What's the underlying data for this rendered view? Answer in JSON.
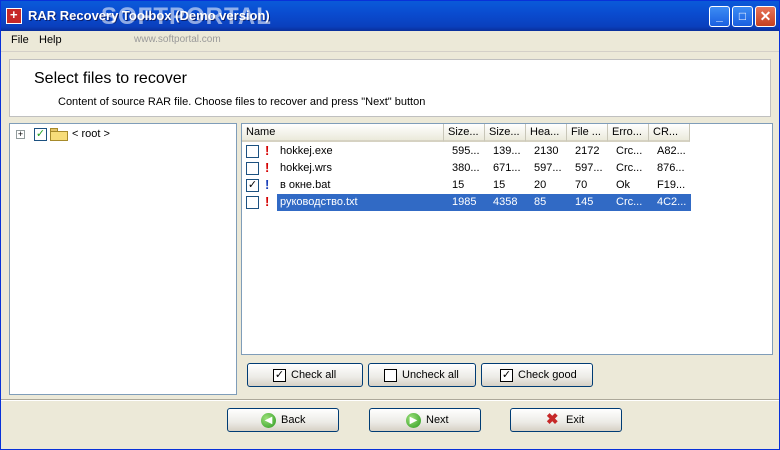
{
  "window": {
    "title": "RAR Recovery Toolbox (Demo version)",
    "watermark": "SOFTPORTAL",
    "controls": {
      "minimize": "_",
      "maximize": "□",
      "close": "✕"
    }
  },
  "menu": {
    "file": "File",
    "help": "Help",
    "watermark_url": "www.softportal.com"
  },
  "header": {
    "title": "Select files to recover",
    "subtitle": "Content of source RAR file. Choose files to recover and press \"Next\" button"
  },
  "tree": {
    "root_label": "< root >",
    "checked": true,
    "expand_glyph": "+"
  },
  "file_list": {
    "columns": [
      "Name",
      "Size...",
      "Size...",
      "Hea...",
      "File ...",
      "Erro...",
      "CR..."
    ],
    "rows": [
      {
        "checked": false,
        "status": "error",
        "cells": [
          "hokkej.exe",
          "595...",
          "139...",
          "2130",
          "2172",
          "Crc...",
          "A82..."
        ]
      },
      {
        "checked": false,
        "status": "error",
        "cells": [
          "hokkej.wrs",
          "380...",
          "671...",
          "597...",
          "597...",
          "Crc...",
          "876..."
        ]
      },
      {
        "checked": true,
        "status": "ok",
        "cells": [
          "в окне.bat",
          "15",
          "15",
          "20",
          "70",
          "Ok",
          "F19..."
        ]
      },
      {
        "checked": false,
        "status": "error",
        "selected": true,
        "cells": [
          "руководство.txt",
          "1985",
          "4358",
          "85",
          "145",
          "Crc...",
          "4C2..."
        ]
      }
    ]
  },
  "check_buttons": {
    "check_all": "Check all",
    "uncheck_all": "Uncheck all",
    "check_good": "Check good"
  },
  "nav_buttons": {
    "back": "Back",
    "next": "Next",
    "exit": "Exit"
  },
  "icons": {
    "error_mark": "!",
    "check_mark": "✓",
    "back_arrow": "◀",
    "next_arrow": "▶",
    "exit_x": "✖"
  },
  "colors": {
    "title_bar": "#0a4cd0",
    "selection": "#316ac5",
    "error_mark": "#d40000",
    "ok_mark": "#1a3fb8"
  }
}
